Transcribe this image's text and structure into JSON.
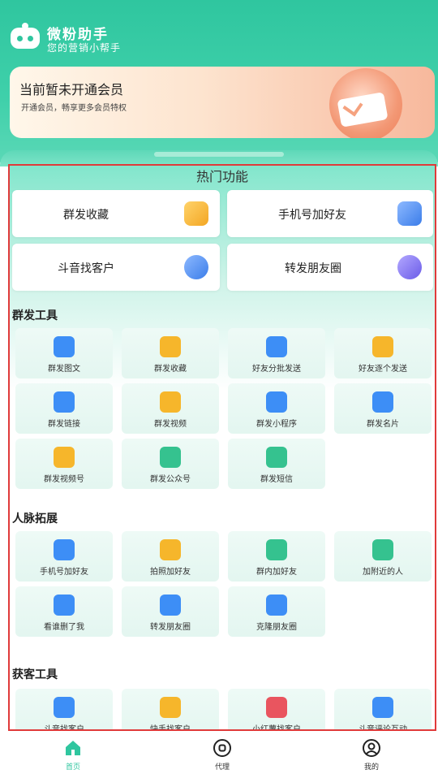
{
  "header": {
    "title": "微粉助手",
    "subtitle": "您的营销小帮手"
  },
  "vip": {
    "title": "当前暂未开通会员",
    "desc": "开通会员，畅享更多会员特权"
  },
  "hot": {
    "title": "热门功能",
    "items": [
      {
        "label": "群发收藏",
        "icon": "star-folder-icon",
        "color": "#f8b842"
      },
      {
        "label": "手机号加好友",
        "icon": "phone-book-icon",
        "color": "#4f8cf5"
      },
      {
        "label": "斗音找客户",
        "icon": "users-icon",
        "color": "#4f8cf5"
      },
      {
        "label": "转发朋友圈",
        "icon": "share-arrow-icon",
        "color": "#7b6cf0"
      }
    ]
  },
  "groups": [
    {
      "title": "群发工具",
      "items": [
        {
          "label": "群发图文",
          "icon": "chat-bubble-icon",
          "color": "#3d8ef6"
        },
        {
          "label": "群发收藏",
          "icon": "star-card-icon",
          "color": "#f6b62b"
        },
        {
          "label": "好友分批发送",
          "icon": "batch-send-icon",
          "color": "#3d8ef6"
        },
        {
          "label": "好友逐个发送",
          "icon": "person-card-icon",
          "color": "#f6b62b"
        },
        {
          "label": "群发链接",
          "icon": "message-dots-icon",
          "color": "#3d8ef6"
        },
        {
          "label": "群发视频",
          "icon": "tv-play-icon",
          "color": "#f6b62b"
        },
        {
          "label": "群发小程序",
          "icon": "mini-program-icon",
          "color": "#3d8ef6"
        },
        {
          "label": "群发名片",
          "icon": "id-card-icon",
          "color": "#3d8ef6"
        },
        {
          "label": "群发视频号",
          "icon": "video-channel-icon",
          "color": "#f6b62b"
        },
        {
          "label": "群发公众号",
          "icon": "official-account-icon",
          "color": "#35c28f"
        },
        {
          "label": "群发短信",
          "icon": "sms-icon",
          "color": "#35c28f"
        }
      ]
    },
    {
      "title": "人脉拓展",
      "items": [
        {
          "label": "手机号加好友",
          "icon": "phone-contact-icon",
          "color": "#3d8ef6"
        },
        {
          "label": "拍照加好友",
          "icon": "camera-icon",
          "color": "#f6b62b"
        },
        {
          "label": "群内加好友",
          "icon": "group-home-icon",
          "color": "#35c28f"
        },
        {
          "label": "加附近的人",
          "icon": "location-pin-icon",
          "color": "#35c28f"
        },
        {
          "label": "看谁删了我",
          "icon": "trash-bag-icon",
          "color": "#3d8ef6"
        },
        {
          "label": "转发朋友圈",
          "icon": "moments-lens-icon",
          "color": "#3d8ef6"
        },
        {
          "label": "克隆朋友圈",
          "icon": "clone-lens-icon",
          "color": "#3d8ef6"
        }
      ]
    },
    {
      "title": "获客工具",
      "items": [
        {
          "label": "斗音找客户",
          "icon": "tiktok-icon",
          "color": "#3d8ef6"
        },
        {
          "label": "快手找客户",
          "icon": "kuaishou-icon",
          "color": "#f6b62b"
        },
        {
          "label": "小红薯找客户",
          "icon": "xiaohongshu-icon",
          "color": "#e9555f"
        },
        {
          "label": "斗音评论互动",
          "icon": "comment-interact-icon",
          "color": "#3d8ef6"
        }
      ]
    }
  ],
  "nav": [
    {
      "label": "首页",
      "icon": "home-icon",
      "active": true
    },
    {
      "label": "代理",
      "icon": "agent-circle-icon",
      "active": false
    },
    {
      "label": "我的",
      "icon": "profile-icon",
      "active": false
    }
  ],
  "colors": {
    "brand": "#2fc69f",
    "highlight_border": "#e03a3a"
  }
}
